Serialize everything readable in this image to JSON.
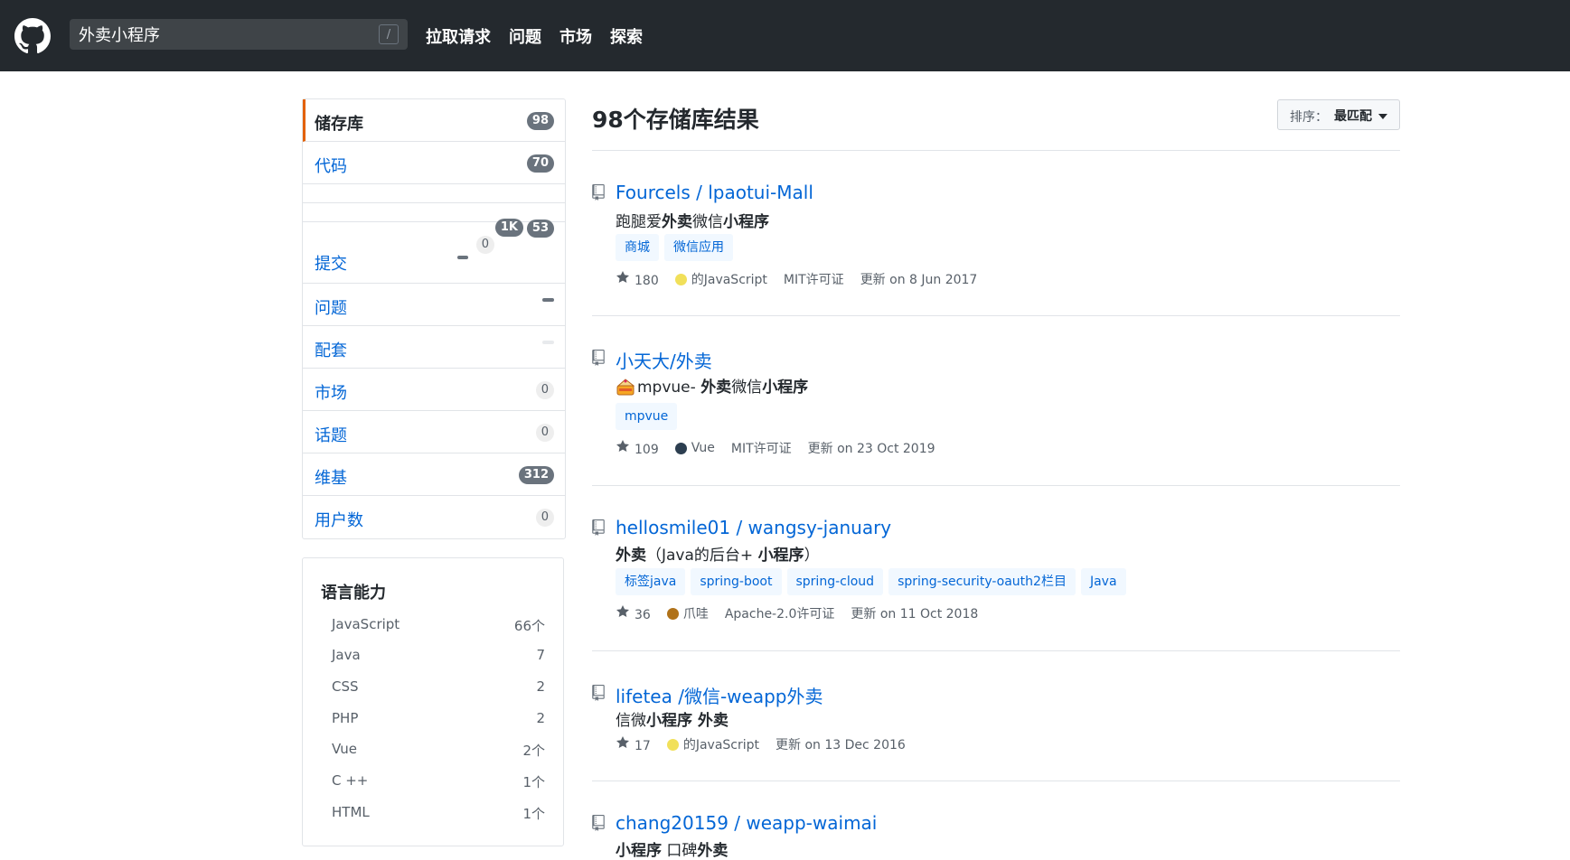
{
  "header": {
    "search": {
      "value": "外卖小程序",
      "shortcut": "/"
    },
    "nav": [
      "拉取请求",
      "问题",
      "市场",
      "探索"
    ]
  },
  "sidebar": {
    "menu": [
      {
        "label": "储存库",
        "count": "98"
      },
      {
        "label": "代码",
        "count": "70"
      },
      {
        "label": "",
        "count": "53"
      },
      {
        "label": "",
        "count": "1K"
      },
      {
        "label": "提交",
        "count": "0"
      },
      {
        "label": "问题",
        "count": ""
      },
      {
        "label": "配套",
        "count": ""
      },
      {
        "label": "市场",
        "count": "0"
      },
      {
        "label": "话题",
        "count": "0"
      },
      {
        "label": "维基",
        "count": "312"
      },
      {
        "label": "用户数",
        "count": "0"
      }
    ],
    "languages": {
      "title": "语言能力",
      "items": [
        {
          "name": "JavaScript",
          "count": "66个"
        },
        {
          "name": "Java",
          "count": "7"
        },
        {
          "name": "CSS",
          "count": "2"
        },
        {
          "name": "PHP",
          "count": "2"
        },
        {
          "name": "Vue",
          "count": "2个"
        },
        {
          "name": "C ++",
          "count": "1个"
        },
        {
          "name": "HTML",
          "count": "1个"
        }
      ]
    }
  },
  "main": {
    "title": "98个存储库结果",
    "sort": {
      "label": "排序：",
      "value": "最匹配"
    },
    "repos": [
      {
        "name": "Fourcels / lpaotui-Mall",
        "desc": [
          [
            "跑腿爱",
            false
          ],
          [
            "外卖",
            true
          ],
          [
            "微信",
            false
          ],
          [
            "小程序",
            true
          ]
        ],
        "topics": [
          "商城",
          "微信应用"
        ],
        "stars": "180",
        "lang": "的JavaScript",
        "lang_color": "#f1e05a",
        "license": "MIT许可证",
        "updated": "更新 on 8 Jun 2017"
      },
      {
        "name": "小天大/外卖",
        "emoji": "cake-emoji",
        "desc": [
          [
            "mpvue- ",
            false
          ],
          [
            "外卖",
            true
          ],
          [
            "微信",
            false
          ],
          [
            "小程序",
            true
          ]
        ],
        "topics": [
          "mpvue"
        ],
        "stars": "109",
        "lang": "Vue",
        "lang_color": "#2c3e50",
        "license": "MIT许可证",
        "updated": "更新 on 23 Oct 2019"
      },
      {
        "name": "hellosmile01 / wangsy-january",
        "desc": [
          [
            "外卖",
            true
          ],
          [
            "（Java的后台+ ",
            false
          ],
          [
            "小程序",
            true
          ],
          [
            "）",
            false
          ]
        ],
        "topics": [
          "标签java",
          "spring-boot",
          "spring-cloud",
          "spring-security-oauth2栏目",
          "Java"
        ],
        "stars": "36",
        "lang": "爪哇",
        "lang_color": "#b07219",
        "license": "Apache-2.0许可证",
        "updated": "更新 on 11 Oct 2018"
      },
      {
        "name": "lifetea /微信-weapp外卖",
        "desc": [
          [
            "信微",
            false
          ],
          [
            "小程序 外卖",
            true
          ]
        ],
        "topics": [],
        "stars": "17",
        "lang": "的JavaScript",
        "lang_color": "#f1e05a",
        "license": "",
        "updated": "更新 on 13 Dec 2016"
      },
      {
        "name": "chang20159 / weapp-waimai",
        "desc": [
          [
            "小程序",
            true
          ],
          [
            " 口碑",
            false
          ],
          [
            "外卖",
            true
          ]
        ],
        "topics": [],
        "stars": "",
        "lang": "",
        "license": "",
        "updated": ""
      }
    ]
  }
}
